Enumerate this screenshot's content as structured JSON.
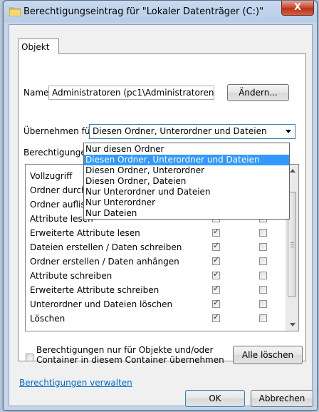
{
  "window": {
    "title": "Berechtigungseintrag für \"Lokaler Datenträger (C:)\"",
    "close_label": "X"
  },
  "tabs": [
    {
      "label": "Objekt",
      "active": true
    }
  ],
  "name": {
    "label": "Name:",
    "value": "Administratoren (pc1\\Administratoren)",
    "change_button": "Ändern..."
  },
  "apply_to": {
    "label": "Übernehmen für:",
    "selected": "Diesen Ordner, Unterordner und Dateien",
    "options": [
      "Nur diesen Ordner",
      "Diesen Ordner, Unterordner und Dateien",
      "Diesen Ordner, Unterordner",
      "Diesen Ordner, Dateien",
      "Nur Unterordner und Dateien",
      "Nur Unterordner",
      "Nur Dateien"
    ],
    "highlighted_index": 1
  },
  "permissions": {
    "label": "Berechtigungen:",
    "rows": [
      {
        "name": "Vollzugriff",
        "allow": false,
        "deny": false
      },
      {
        "name": "Ordner durchsuchen / Datei ausführen",
        "allow": true,
        "deny": false
      },
      {
        "name": "Ordner auflisten / Daten lesen",
        "allow": true,
        "deny": false
      },
      {
        "name": "Attribute lesen",
        "allow": true,
        "deny": false
      },
      {
        "name": "Erweiterte Attribute lesen",
        "allow": true,
        "deny": false
      },
      {
        "name": "Dateien erstellen / Daten schreiben",
        "allow": true,
        "deny": false
      },
      {
        "name": "Ordner erstellen / Daten anhängen",
        "allow": true,
        "deny": false
      },
      {
        "name": "Attribute schreiben",
        "allow": true,
        "deny": false
      },
      {
        "name": "Erweiterte Attribute schreiben",
        "allow": true,
        "deny": false
      },
      {
        "name": "Unterordner und Dateien löschen",
        "allow": true,
        "deny": false
      },
      {
        "name": "Löschen",
        "allow": true,
        "deny": false
      }
    ]
  },
  "inherit_checkbox": {
    "line1": "Berechtigungen nur für Objekte und/oder",
    "line2": "Container in diesem Container übernehmen",
    "checked": false
  },
  "clear_all_button": "Alle löschen",
  "manage_link": "Berechtigungen verwalten",
  "footer": {
    "ok": "OK",
    "cancel": "Abbrechen"
  }
}
